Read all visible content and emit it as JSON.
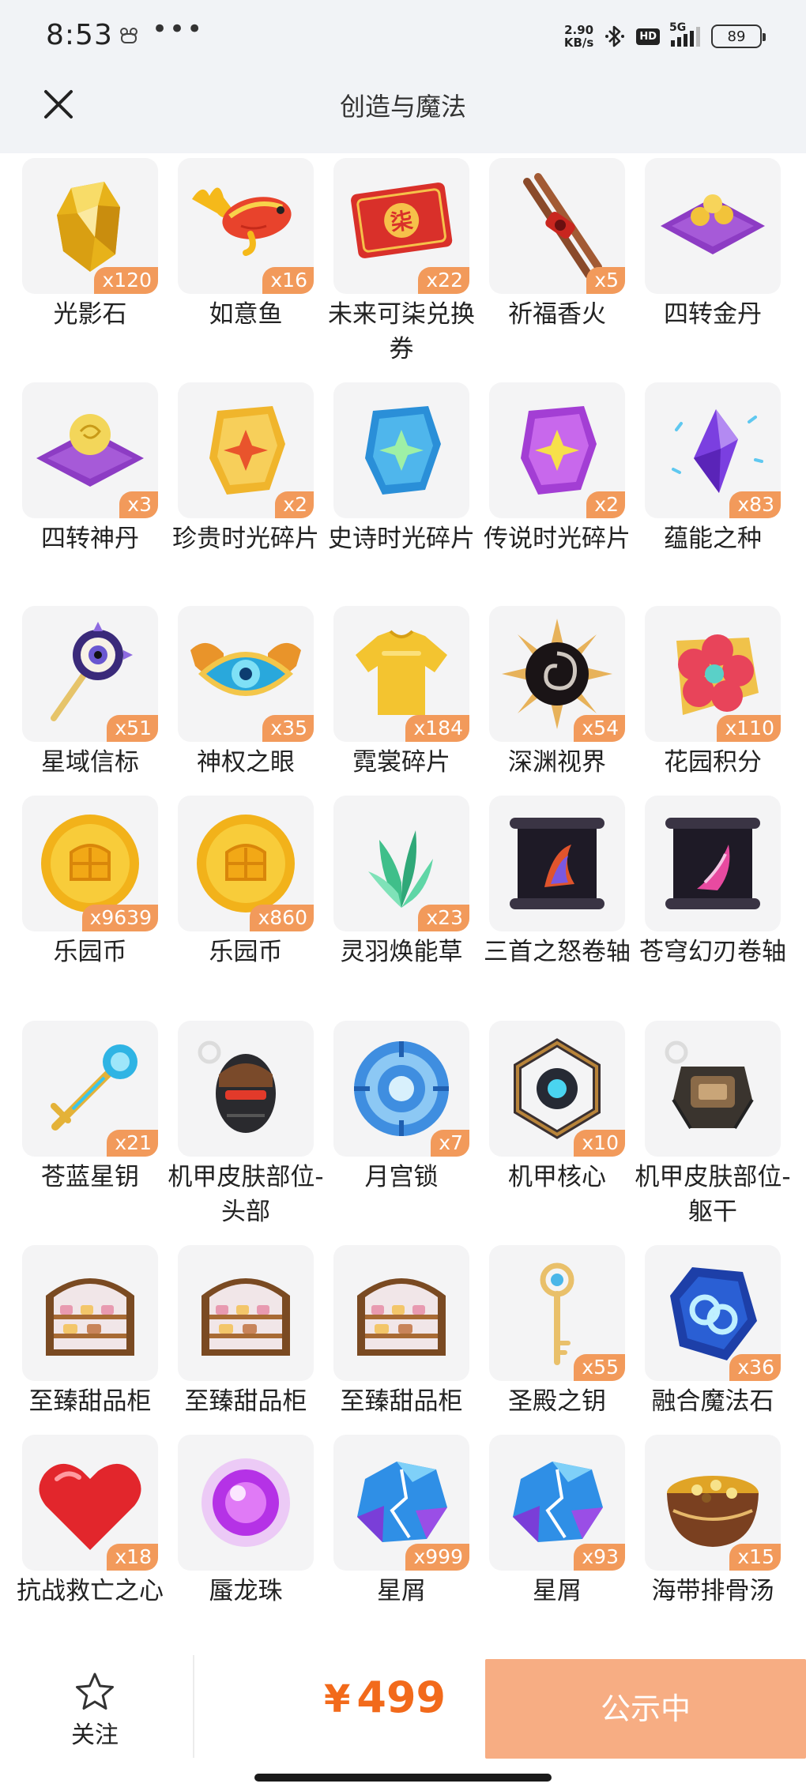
{
  "status_bar": {
    "time": "8:53",
    "net_speed_value": "2.90",
    "net_speed_unit": "KB/s",
    "hd_label": "HD",
    "signal_label": "5G",
    "battery": "89"
  },
  "header": {
    "title": "创造与魔法"
  },
  "items": [
    {
      "name": "光影石",
      "qty": "x120"
    },
    {
      "name": "如意鱼",
      "qty": "x16"
    },
    {
      "name": "未来可柒兑换券",
      "qty": "x22"
    },
    {
      "name": "祈福香火",
      "qty": "x5"
    },
    {
      "name": "四转金丹",
      "qty": ""
    },
    {
      "name": "四转神丹",
      "qty": "x3"
    },
    {
      "name": "珍贵时光碎片",
      "qty": "x2"
    },
    {
      "name": "史诗时光碎片",
      "qty": ""
    },
    {
      "name": "传说时光碎片",
      "qty": "x2"
    },
    {
      "name": "蕴能之种",
      "qty": "x83"
    },
    {
      "name": "星域信标",
      "qty": "x51"
    },
    {
      "name": "神权之眼",
      "qty": "x35"
    },
    {
      "name": "霓裳碎片",
      "qty": "x184"
    },
    {
      "name": "深渊视界",
      "qty": "x54"
    },
    {
      "name": "花园积分",
      "qty": "x110"
    },
    {
      "name": "乐园币",
      "qty": "x9639"
    },
    {
      "name": "乐园币",
      "qty": "x860"
    },
    {
      "name": "灵羽焕能草",
      "qty": "x23"
    },
    {
      "name": "三首之怒卷轴",
      "qty": ""
    },
    {
      "name": "苍穹幻刃卷轴",
      "qty": ""
    },
    {
      "name": "苍蓝星钥",
      "qty": "x21"
    },
    {
      "name": "机甲皮肤部位-头部",
      "qty": ""
    },
    {
      "name": "月宫锁",
      "qty": "x7"
    },
    {
      "name": "机甲核心",
      "qty": "x10"
    },
    {
      "name": "机甲皮肤部位-躯干",
      "qty": ""
    },
    {
      "name": "至臻甜品柜",
      "qty": ""
    },
    {
      "name": "至臻甜品柜",
      "qty": ""
    },
    {
      "name": "至臻甜品柜",
      "qty": ""
    },
    {
      "name": "圣殿之钥",
      "qty": "x55"
    },
    {
      "name": "融合魔法石",
      "qty": "x36"
    },
    {
      "name": "抗战救亡之心",
      "qty": "x18"
    },
    {
      "name": "蜃龙珠",
      "qty": ""
    },
    {
      "name": "星屑",
      "qty": "x999"
    },
    {
      "name": "星屑",
      "qty": "x93"
    },
    {
      "name": "海带排骨汤",
      "qty": "x15"
    }
  ],
  "bottom_bar": {
    "follow_label": "关注",
    "price_symbol": "¥",
    "price_value": "499",
    "action_label": "公示中"
  },
  "colors": {
    "accent": "#f26a1b",
    "qty_badge": "#f29a5b",
    "action_button": "#f7ad83",
    "header_bg": "#f1f3f6"
  }
}
